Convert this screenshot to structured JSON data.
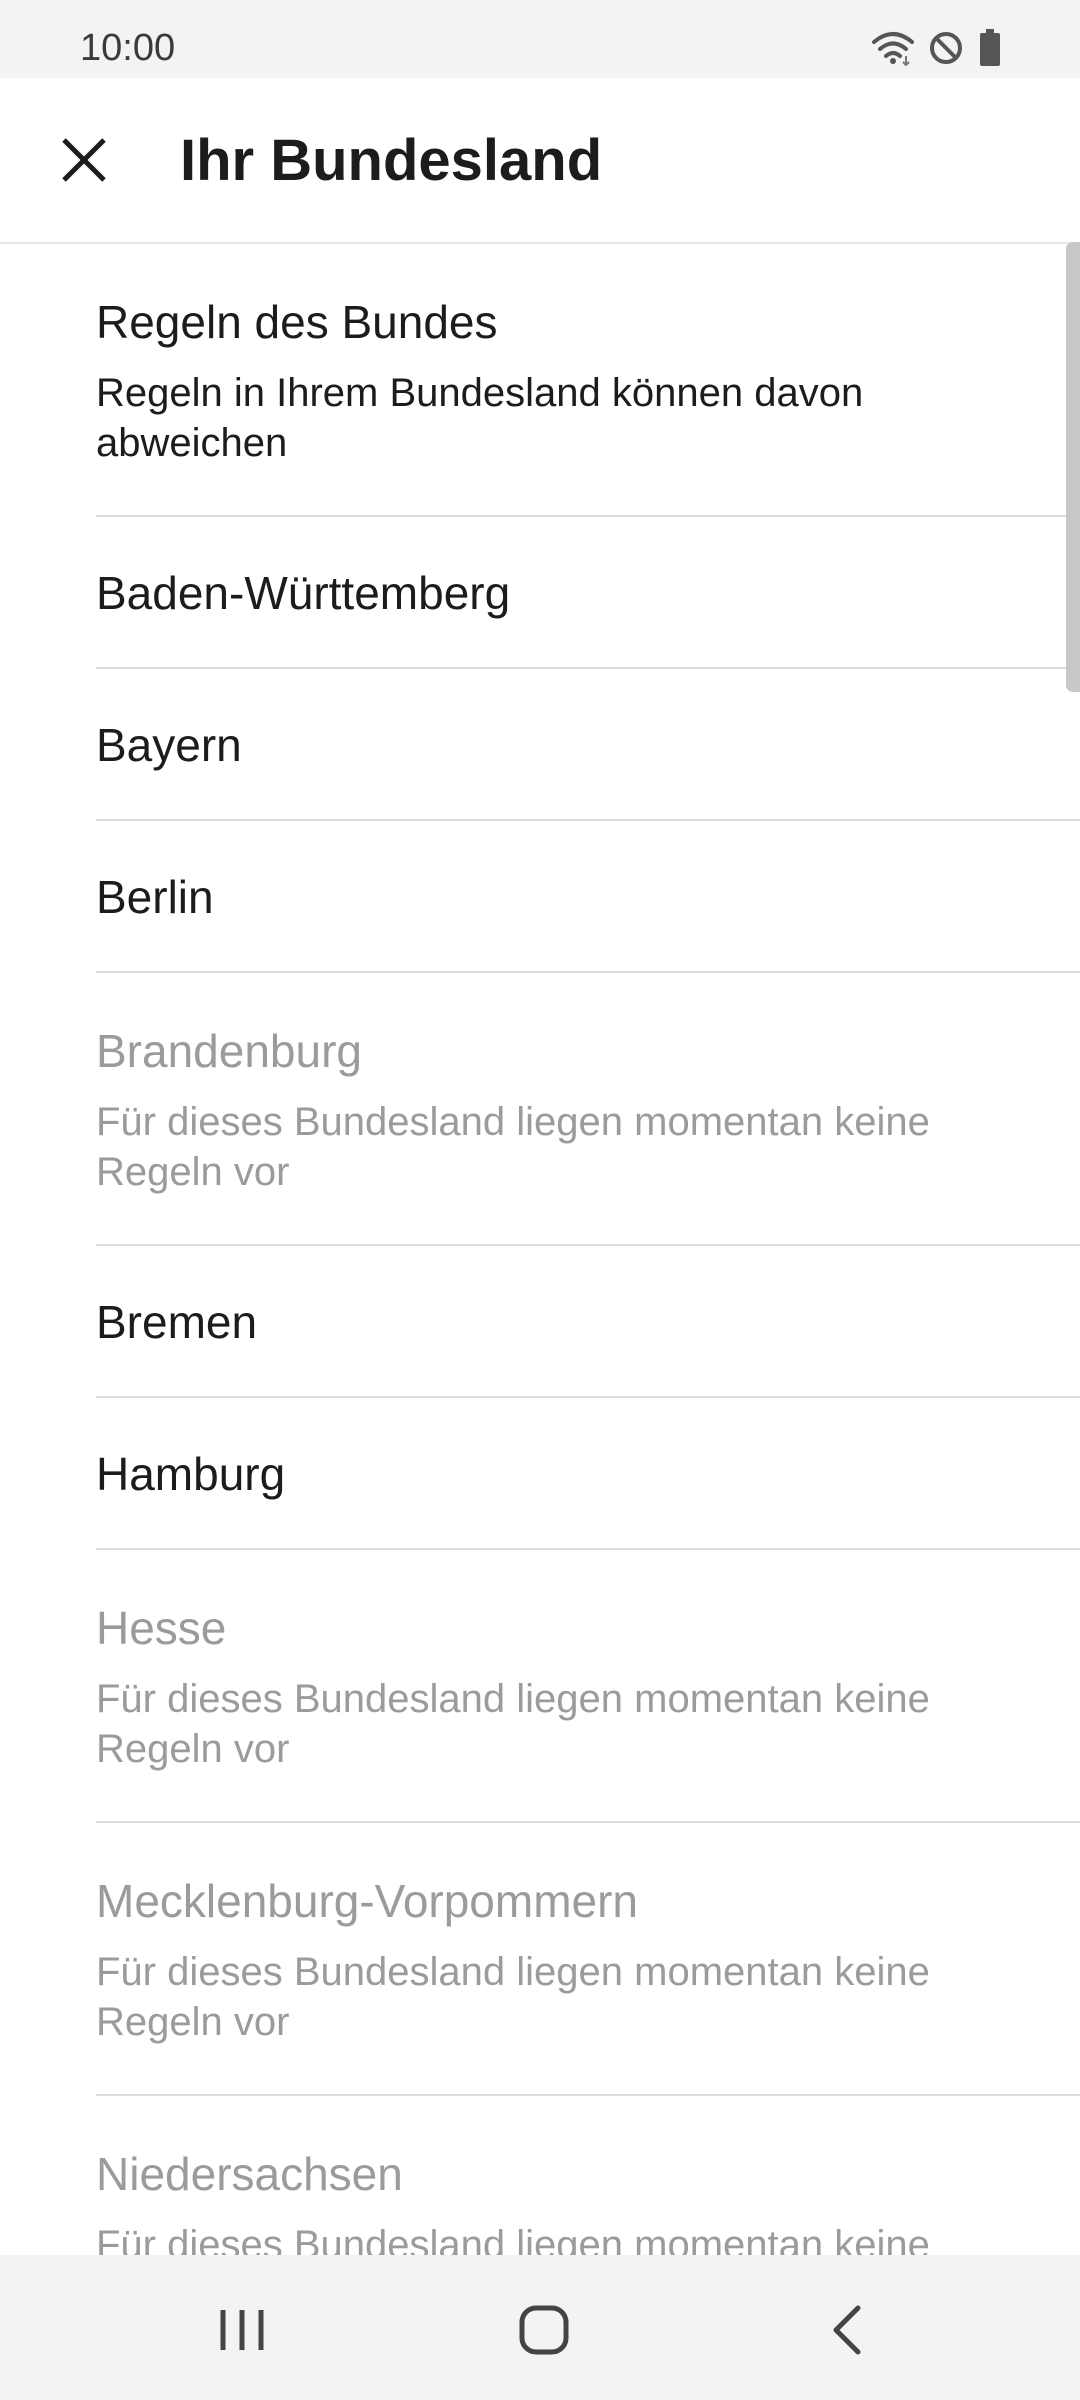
{
  "status_bar": {
    "time": "10:00",
    "icons": [
      "wifi-icon",
      "do-not-disturb-icon",
      "battery-icon"
    ]
  },
  "app_bar": {
    "title": "Ihr Bundesland",
    "close_icon": "close-icon"
  },
  "list": {
    "items": [
      {
        "title": "Regeln des Bundes",
        "subtitle": "Regeln in Ihrem Bundesland können davon abweichen",
        "enabled": true
      },
      {
        "title": "Baden-Württemberg",
        "enabled": true
      },
      {
        "title": "Bayern",
        "enabled": true
      },
      {
        "title": "Berlin",
        "enabled": true
      },
      {
        "title": "Brandenburg",
        "subtitle": "Für dieses Bundesland liegen momentan keine Regeln vor",
        "enabled": false
      },
      {
        "title": "Bremen",
        "enabled": true
      },
      {
        "title": "Hamburg",
        "enabled": true
      },
      {
        "title": "Hesse",
        "subtitle": "Für dieses Bundesland liegen momentan keine Regeln vor",
        "enabled": false
      },
      {
        "title": "Mecklenburg-Vorpommern",
        "subtitle": "Für dieses Bundesland liegen momentan keine Regeln vor",
        "enabled": false
      },
      {
        "title": "Niedersachsen",
        "subtitle": "Für dieses Bundesland liegen momentan keine Regeln vor",
        "enabled": false
      }
    ]
  },
  "nav_bar": {
    "buttons": [
      "recent-apps-icon",
      "home-icon",
      "back-icon"
    ]
  },
  "colors": {
    "text_primary": "#1c1c1c",
    "text_disabled": "#9b9b9b",
    "divider": "#dcdcdc",
    "system_bar_bg": "#f3f3f3"
  }
}
